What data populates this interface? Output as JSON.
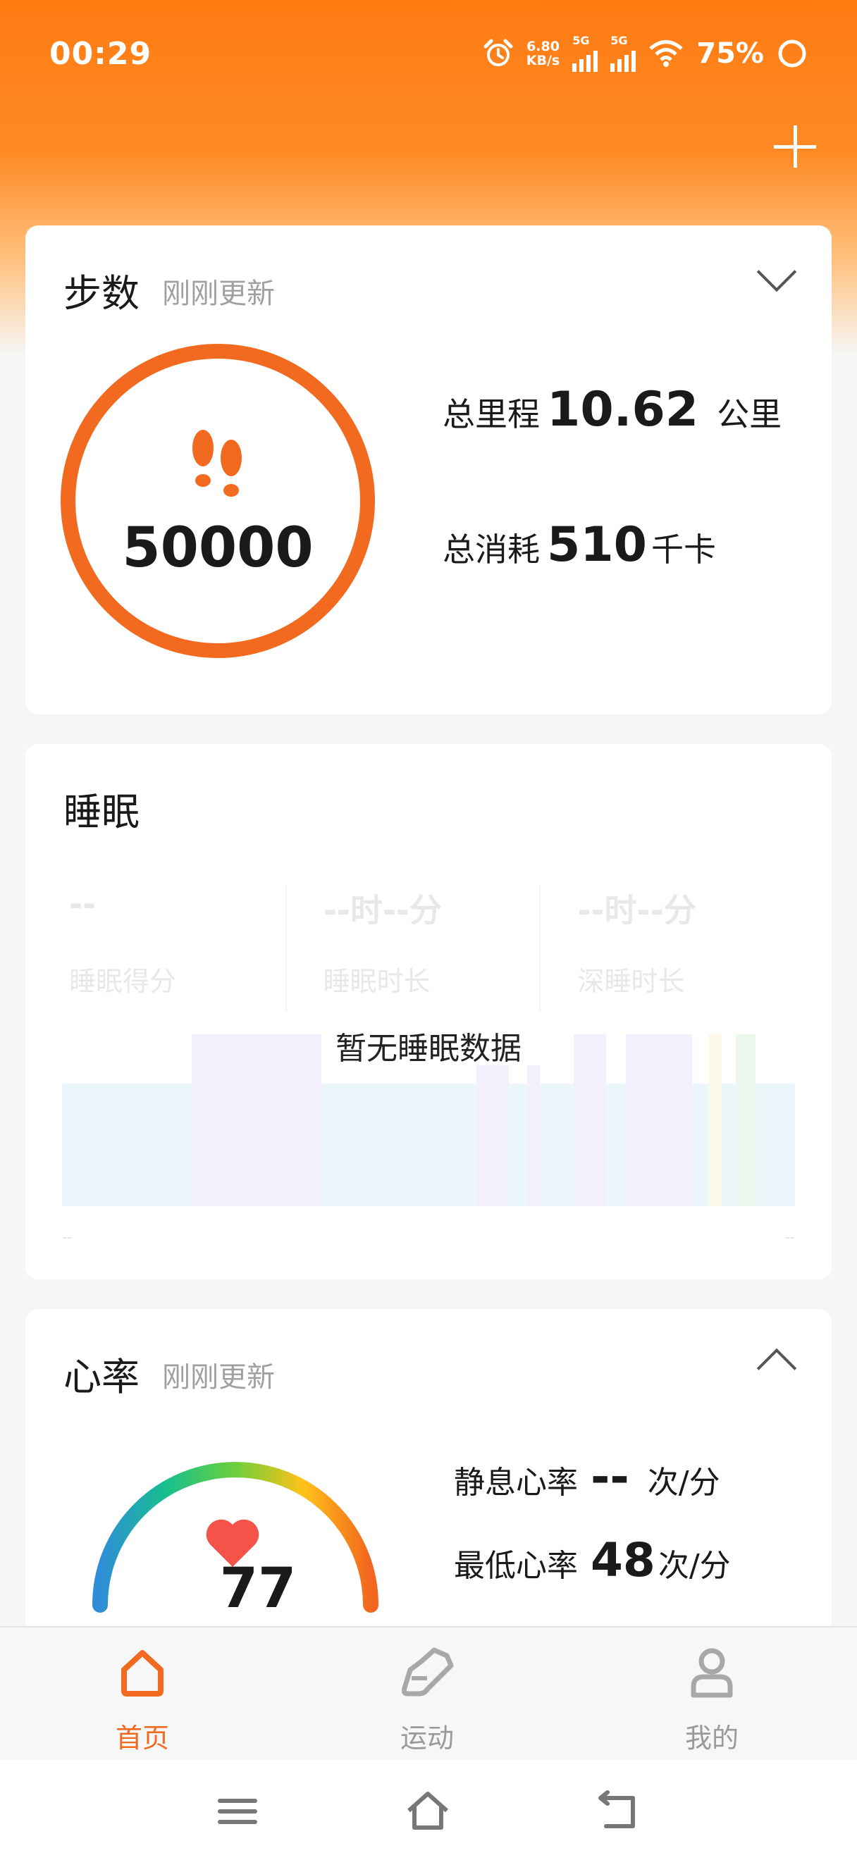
{
  "status_bar": {
    "time": "00:29",
    "net_speed": "6.80",
    "net_unit": "KB/s",
    "sim1": "5G",
    "sim2": "5G",
    "battery": "75%"
  },
  "steps_card": {
    "title": "步数",
    "subtitle": "刚刚更新",
    "step_count": "50000",
    "distance_label": "总里程",
    "distance_value": "10.62",
    "distance_unit": "公里",
    "calories_label": "总消耗",
    "calories_value": "510",
    "calories_unit": "千卡"
  },
  "sleep_card": {
    "title": "睡眠",
    "metrics": [
      {
        "value": "--",
        "label": "睡眠得分"
      },
      {
        "value": "--时--分",
        "label": "睡眠时长"
      },
      {
        "value": "--时--分",
        "label": "深睡时长"
      }
    ],
    "empty_message": "暂无睡眠数据",
    "axis_start": "--",
    "axis_end": "--"
  },
  "heart_card": {
    "title": "心率",
    "subtitle": "刚刚更新",
    "current_value": "77",
    "resting_label": "静息心率",
    "resting_value": "--",
    "resting_unit": "次/分",
    "min_label": "最低心率",
    "min_value": "48",
    "min_unit": "次/分"
  },
  "tab_bar": {
    "items": [
      {
        "label": "首页",
        "icon": "home-icon",
        "active": true
      },
      {
        "label": "运动",
        "icon": "shoe-icon",
        "active": false
      },
      {
        "label": "我的",
        "icon": "profile-icon",
        "active": false
      }
    ]
  },
  "colors": {
    "accent": "#f26a1f",
    "header_orange": "#ff7b12",
    "heart_red": "#f5524a",
    "inactive_gray": "#9a9a9a"
  }
}
